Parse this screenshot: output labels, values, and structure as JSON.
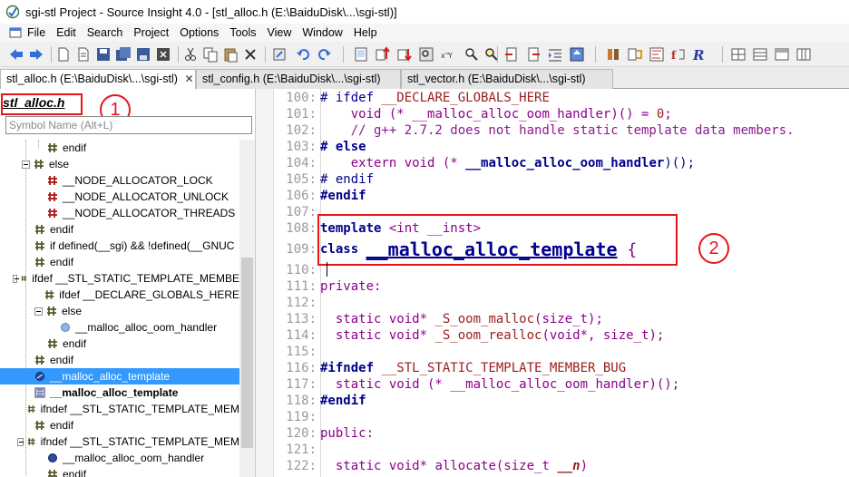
{
  "window": {
    "title": "sgi-stl Project - Source Insight 4.0 - [stl_alloc.h (E:\\BaiduDisk\\...\\sgi-stl)]"
  },
  "menu": [
    {
      "label": "File",
      "icon": "window-icon"
    },
    {
      "label": "Edit"
    },
    {
      "label": "Search"
    },
    {
      "label": "Project"
    },
    {
      "label": "Options"
    },
    {
      "label": "Tools"
    },
    {
      "label": "View"
    },
    {
      "label": "Window"
    },
    {
      "label": "Help"
    }
  ],
  "tabs": [
    {
      "label": "stl_alloc.h (E:\\BaiduDisk\\...\\sgi-stl)",
      "close": "✕",
      "active": true
    },
    {
      "label": "stl_config.h (E:\\BaiduDisk\\...\\sgi-stl)",
      "active": false
    },
    {
      "label": "stl_vector.h (E:\\BaiduDisk\\...\\sgi-stl)",
      "active": false
    }
  ],
  "symbol_panel": {
    "file_title": "stl_alloc.h",
    "search_placeholder": "Symbol Name (Alt+L)",
    "items": [
      {
        "label": "endif",
        "icon": "macro-icon"
      },
      {
        "label": "else",
        "icon": "macro-icon"
      },
      {
        "label": "__NODE_ALLOCATOR_LOCK",
        "icon": "define-icon"
      },
      {
        "label": "__NODE_ALLOCATOR_UNLOCK",
        "icon": "define-icon"
      },
      {
        "label": "__NODE_ALLOCATOR_THREADS",
        "icon": "define-icon"
      },
      {
        "label": "endif",
        "icon": "macro-icon"
      },
      {
        "label": "if defined(__sgi) && !defined(__GNUC",
        "icon": "macro-icon"
      },
      {
        "label": "endif",
        "icon": "macro-icon"
      },
      {
        "label": "ifdef __STL_STATIC_TEMPLATE_MEMBE",
        "icon": "macro-icon"
      },
      {
        "label": "ifdef __DECLARE_GLOBALS_HERE",
        "icon": "macro-icon"
      },
      {
        "label": "else",
        "icon": "macro-icon"
      },
      {
        "label": "__malloc_alloc_oom_handler",
        "icon": "variable-icon"
      },
      {
        "label": "endif",
        "icon": "macro-icon"
      },
      {
        "label": "endif",
        "icon": "macro-icon"
      },
      {
        "label": "__malloc_alloc_template",
        "icon": "template-icon"
      },
      {
        "label": "__malloc_alloc_template",
        "icon": "class-icon"
      },
      {
        "label": "ifndef __STL_STATIC_TEMPLATE_MEM",
        "icon": "macro-icon"
      },
      {
        "label": "endif",
        "icon": "macro-icon"
      },
      {
        "label": "ifndef __STL_STATIC_TEMPLATE_MEM",
        "icon": "macro-icon"
      },
      {
        "label": "__malloc_alloc_oom_handler",
        "icon": "function-icon"
      },
      {
        "label": "endif",
        "icon": "macro-icon"
      }
    ],
    "selected_item": "__malloc_alloc_template"
  },
  "annotations": {
    "badge1": "1",
    "badge2": "2"
  },
  "code": {
    "line_numbers": [
      "100:",
      "101:",
      "102:",
      "103:",
      "104:",
      "105:",
      "106:",
      "107:",
      "108:",
      "109:",
      "110:",
      "111:",
      "112:",
      "113:",
      "114:",
      "115:",
      "116:",
      "117:",
      "118:",
      "119:",
      "120:",
      "121:",
      "122:"
    ],
    "l100": {
      "hash": "# ifdef ",
      "macro": "__DECLARE_GLOBALS_HERE"
    },
    "l101": {
      "a": "    void (* ",
      "b": "__malloc_alloc_oom_handler",
      "c": ")() = ",
      "d": "0",
      "e": ";"
    },
    "l102": {
      "comment": "    // g++ 2.7.2 does not handle static template data members."
    },
    "l103": {
      "a": "# else"
    },
    "l104": {
      "a": "    extern void (* ",
      "b": "__malloc_alloc_oom_handler",
      "c": ")();"
    },
    "l105": {
      "a": "# endif"
    },
    "l106": {
      "a": "#endif"
    },
    "l108": {
      "kw": "template ",
      "rest": "<int __inst>"
    },
    "l109": {
      "kw": "class ",
      "name": "__malloc_alloc_template",
      "brace": " {"
    },
    "l111": {
      "a": "private:"
    },
    "l113": {
      "a": "  static void* ",
      "b": "_S_oom_malloc",
      "c": "(size_t);"
    },
    "l114": {
      "a": "  static void* ",
      "b": "_S_oom_realloc",
      "c": "(void*, size_t);"
    },
    "l116": {
      "a": "#ifndef ",
      "b": "__STL_STATIC_TEMPLATE_MEMBER_BUG"
    },
    "l117": {
      "a": "  static void (* ",
      "b": "__malloc_alloc_oom_handler",
      "c": ")();"
    },
    "l118": {
      "a": "#endif"
    },
    "l120": {
      "a": "public:"
    },
    "l122": {
      "a": "  static void* ",
      "b": "allocate",
      "c": "(size_t ",
      "d": "__n",
      "e": ")"
    }
  },
  "colors": {
    "annotation_red": "#e8141a",
    "selection_blue": "#3399ff",
    "keyword_navy": "#00008b",
    "macro_red": "#9b1c1c",
    "comment_purple": "#8b1a8b"
  }
}
